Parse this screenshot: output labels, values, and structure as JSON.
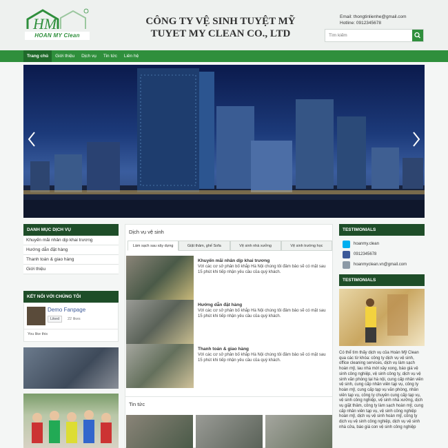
{
  "header": {
    "logo_text": "HOAN MY Clean",
    "company_line1": "CÔNG TY VỆ SINH TUYỆT MỸ",
    "company_line2": "TUYET MY CLEAN CO., LTD",
    "email": "Email: thongtinlienhe@gmail.com",
    "hotline": "Hotline: 0912345678",
    "search_placeholder": "Tìm kiếm"
  },
  "nav": {
    "items": [
      "Trang chủ",
      "Giới thiệu",
      "Dịch vụ",
      "Tin tức",
      "Liên hệ"
    ]
  },
  "sidebar": {
    "services_title": "DANH MỤC DỊCH VỤ",
    "services": [
      "Khuyến mãi nhân dịp khai trương",
      "Hướng dẫn đặt hàng",
      "Thanh toán & giao hàng",
      "Giới thiệu"
    ],
    "connect_title": "KẾT NỐI VỚI CHÚNG TÔI",
    "fanpage_name": "Demo Fanpage",
    "liked_label": "Liked",
    "likes": "22 likes",
    "you_like": "You like this"
  },
  "main": {
    "section_title": "Dịch vụ vệ sinh",
    "tabs": [
      "Làm sạch sau xây dựng",
      "Giặt thảm, ghế Sofa",
      "Vệ sinh nhà xưởng",
      "Vệ sinh trường học"
    ],
    "posts": [
      {
        "title": "Khuyến mãi nhân dịp khai trương",
        "desc": "Với các cơ sở phân bố khắp Hà Nội chúng tôi đảm bảo sẽ có mặt sau 15 phút khi tiếp nhận yêu cầu của quý khách."
      },
      {
        "title": "Hướng dẫn đặt hàng",
        "desc": "Với các cơ sở phân bố khắp Hà Nội chúng tôi đảm bảo sẽ có mặt sau 15 phút khi tiếp nhận yêu cầu của quý khách."
      },
      {
        "title": "Thanh toán & giao hàng",
        "desc": "Với các cơ sở phân bố khắp Hà Nội chúng tôi đảm bảo sẽ có mặt sau 15 phút khi tiếp nhận yêu cầu của quý khách."
      }
    ],
    "news_title": "Tin tức"
  },
  "right": {
    "testimonials_title": "TESTIMONIALS",
    "skype": "hoanmy.clean",
    "phone": "0912345678",
    "email": "hoanmyclean.vn@gmail.com",
    "testimonials_title2": "TESTIMONIALS",
    "text": "Có thể tìm thấy dịch vụ của Hoàn Mỹ Clean qua các từ khóa: công ty dịch vụ vệ sinh, office cleaning services, dịch vụ làm sạch hoàn mỹ, lau nhà mới xây xong, báo giá vệ sinh công nghiệp, vệ sinh công ty, dịch vụ vệ sinh văn phòng tại hà nội, cung cấp nhân viên vệ sinh, cung cấp nhân viên tạp vụ, công ty hoàn mỹ, cung cấp tạp vụ văn phòng, nhân viên tạp vụ, công ty chuyên cung cấp tạp vụ, vệ sinh công nghiệp, vệ sinh nhà xưởng, dịch vụ giặt thảm, công ty làm sạch hoàn mỹ, cung cấp nhân viên tạp vụ, vệ sinh công nghiệp hoàn mỹ, dịch vụ vệ sinh hoàn mỹ, công ty dịch vụ vệ sinh công nghiệp, dịch vụ vệ sinh nhà cửa, báo giá con vệ sinh công nghiệp"
  },
  "colors": {
    "brand_green": "#2f8f3c",
    "dark_green": "#1e4d28"
  }
}
